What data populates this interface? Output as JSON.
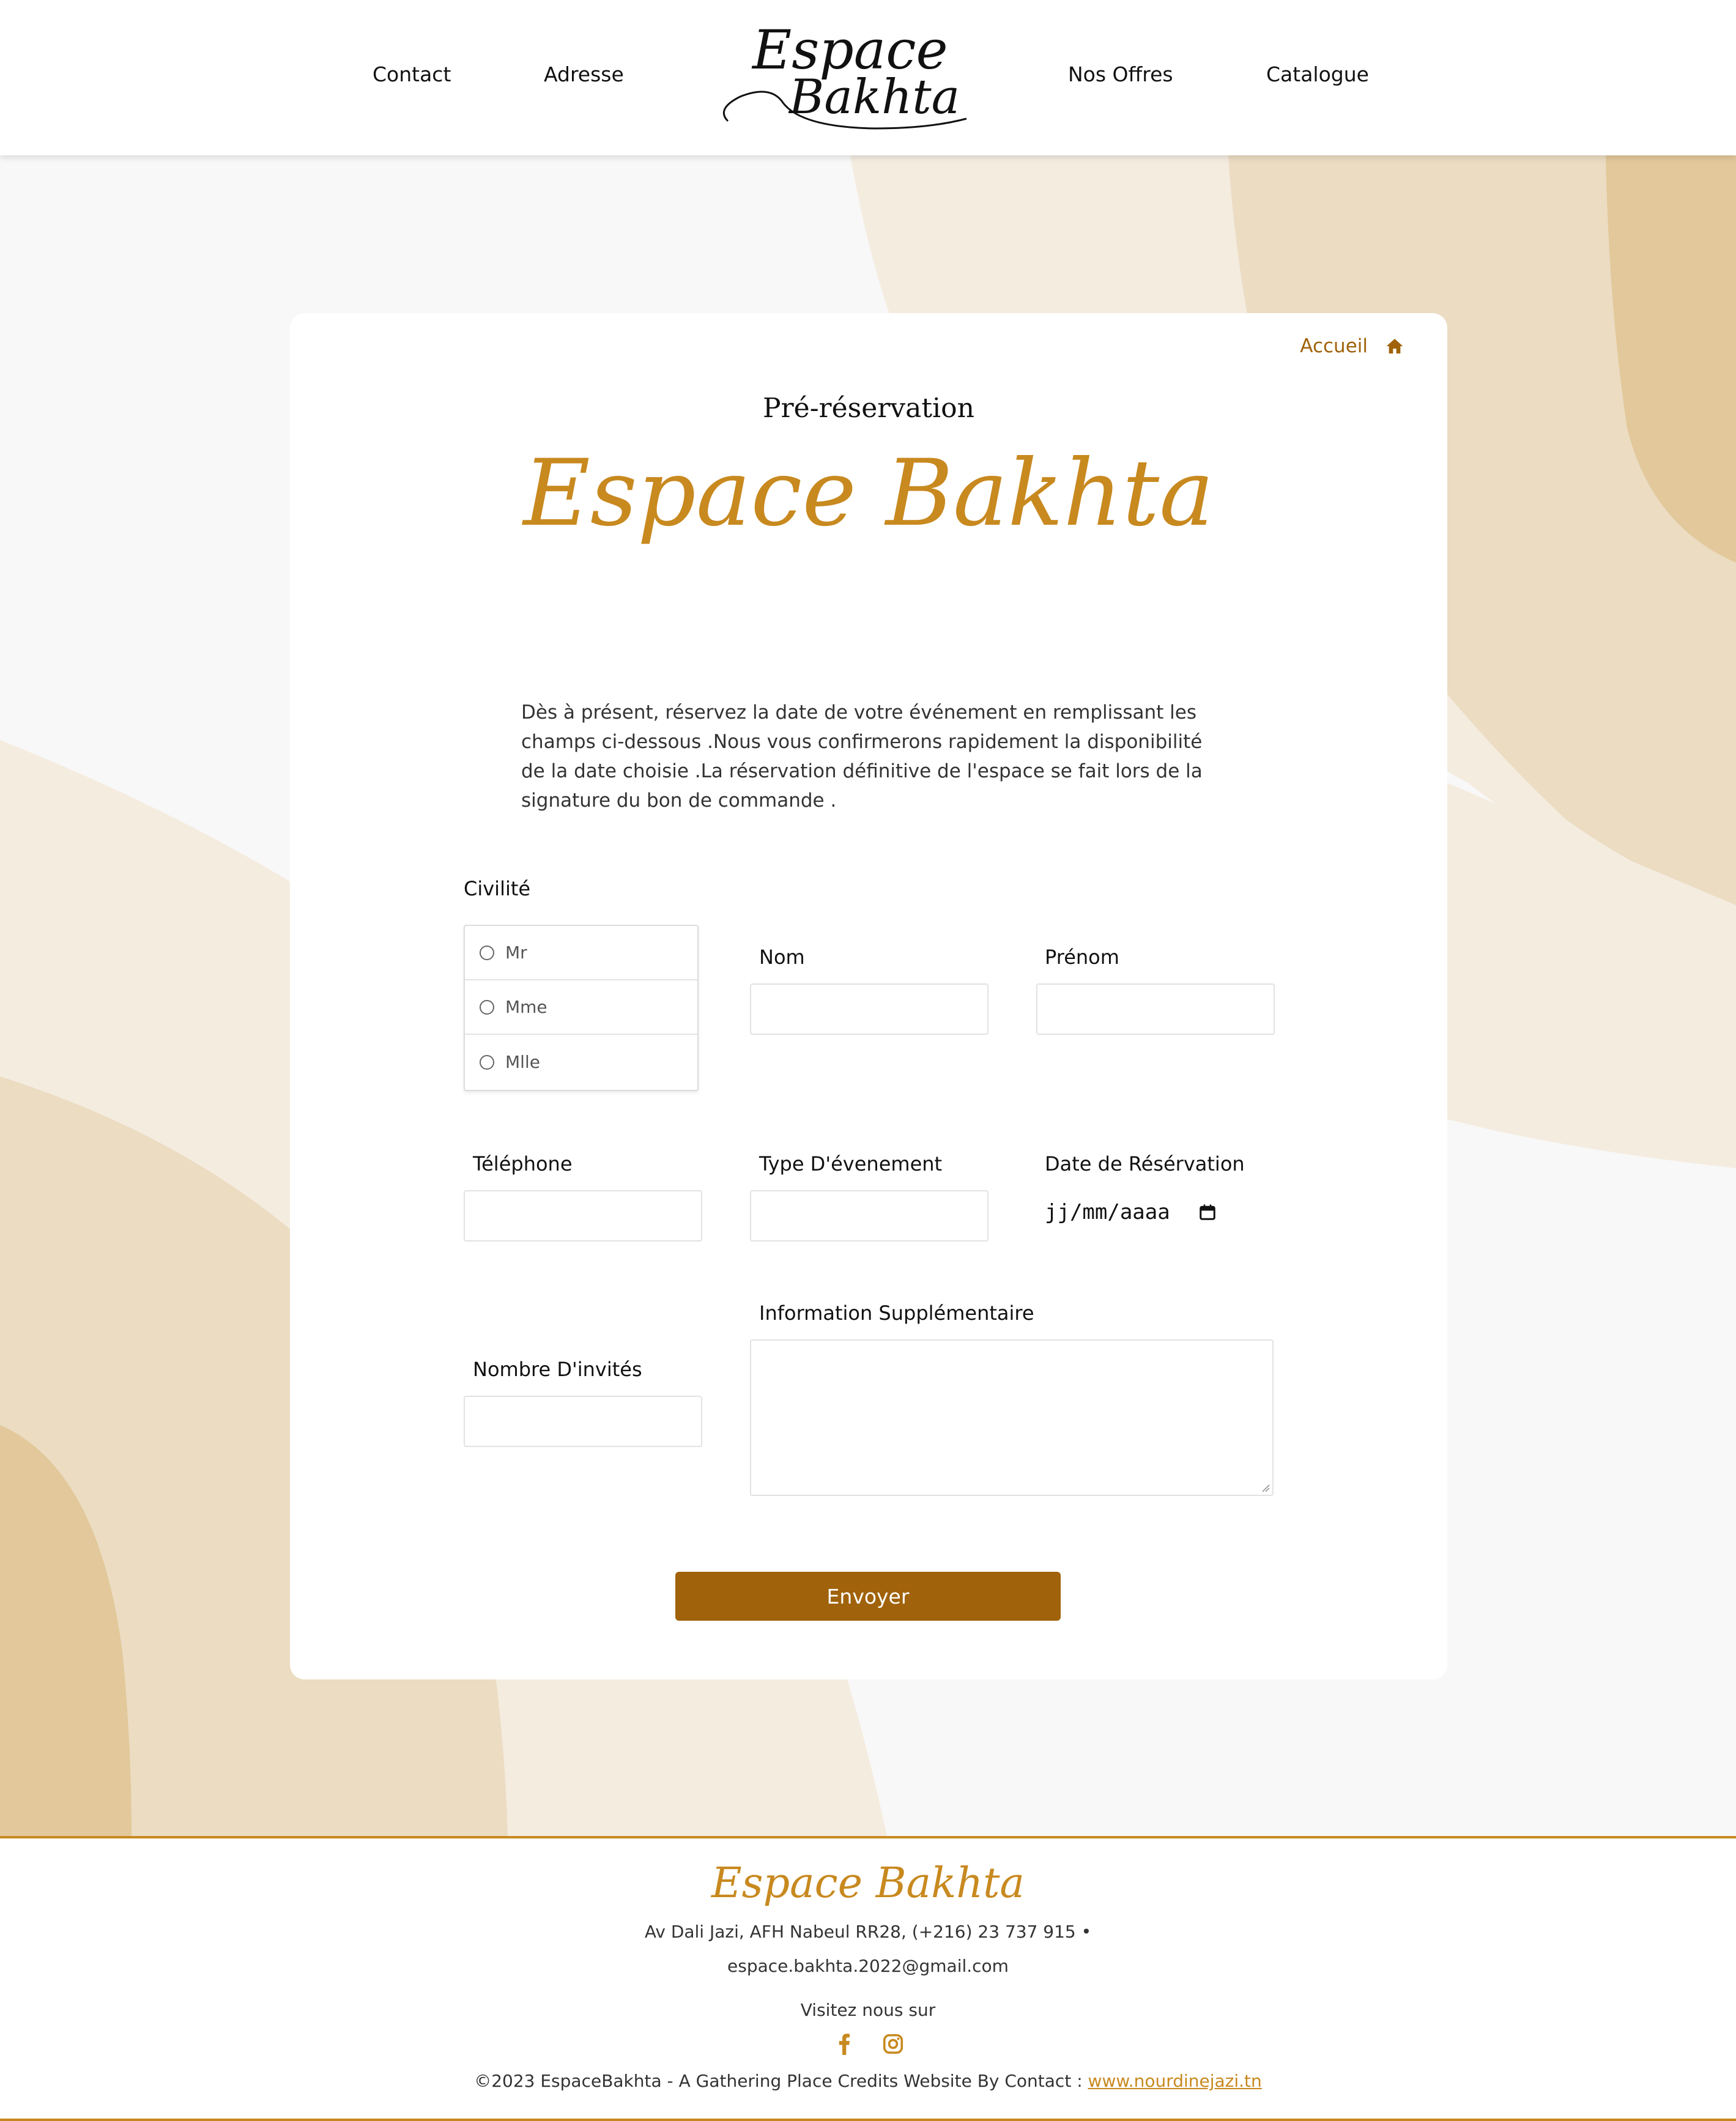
{
  "nav": {
    "left": [
      "Contact",
      "Adresse"
    ],
    "right": [
      "Nos Offres",
      "Catalogue"
    ],
    "logo_line1": "Espace",
    "logo_line2": "Bakhta"
  },
  "card": {
    "breadcrumb": "Accueil",
    "subtitle": "Pré-réservation",
    "title": "Espace Bakhta",
    "intro": "Dès à présent, réservez la date de votre événement en remplissant les champs ci-dessous .Nous vous confirmerons rapidement la disponibilité de la date choisie .La réservation définitive de l'espace se fait lors de la signature du bon de commande ."
  },
  "form": {
    "civilite_label": "Civilité",
    "civilite_options": [
      "Mr",
      "Mme",
      "Mlle"
    ],
    "nom_label": "Nom",
    "prenom_label": "Prénom",
    "telephone_label": "Téléphone",
    "type_label": "Type D'évenement",
    "date_label": "Date de Résérvation",
    "date_placeholder": "jj/mm/aaaa",
    "info_label": "Information Supplémentaire",
    "invites_label": "Nombre D'invités",
    "submit_label": "Envoyer"
  },
  "footer": {
    "title": "Espace Bakhta",
    "address": "Av Dali Jazi, AFH Nabeul RR28, (+216) 23 737 915 •",
    "email": "espace.bakhta.2022@gmail.com",
    "visit": "Visitez nous sur",
    "credits_prefix": "©2023 EspaceBakhta - A Gathering Place Credits Website By Contact : ",
    "credits_link": "www.nourdinejazi.tn"
  },
  "icons": {
    "breadcrumb": "home-icon",
    "date": "calendar-icon",
    "social": [
      "facebook-icon",
      "instagram-icon"
    ]
  },
  "colors": {
    "accent": "#c8891f",
    "button": "#a0620a",
    "bg_light": "#f5ece0",
    "bg_mid": "#ebdcc2",
    "bg_dark": "#e2c89a"
  }
}
